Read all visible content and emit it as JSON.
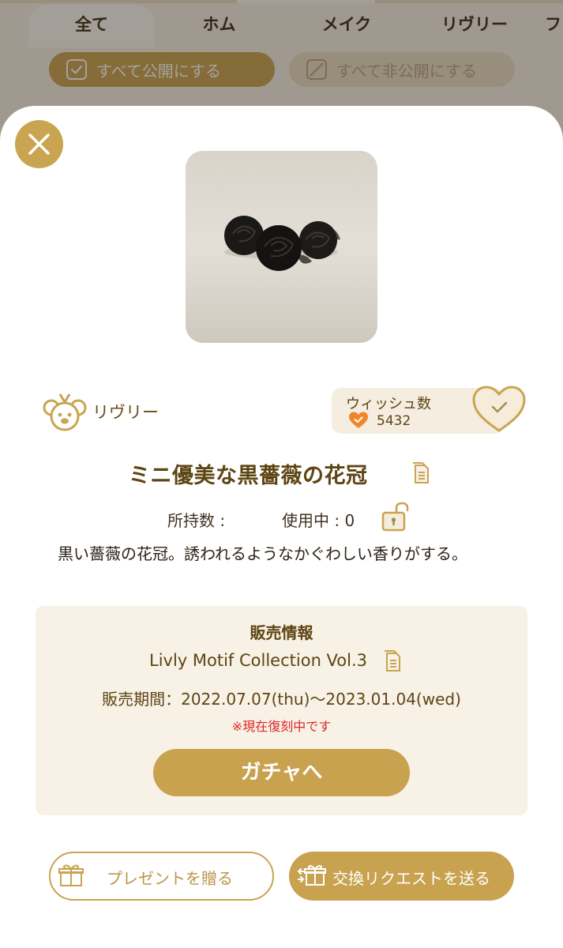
{
  "tabs": [
    {
      "label": "全て",
      "active": true
    },
    {
      "label": "ホム",
      "active": false
    },
    {
      "label": "メイク",
      "active": false
    },
    {
      "label": "リヴリー",
      "active": false
    },
    {
      "label": "フ",
      "active": false
    }
  ],
  "bulk_actions": {
    "publish_all": "すべて公開にする",
    "unpublish_all": "すべて非公開にする"
  },
  "modal": {
    "close_icon": "close-icon",
    "category_label": "リヴリー",
    "category_icon": "livly-face-icon",
    "wish": {
      "title": "ウィッシュ数",
      "count": "5432",
      "icon": "heart-icon"
    },
    "item_name": "ミニ優美な黒薔薇の花冠",
    "owned_label": "所持数 :",
    "owned_value": "",
    "in_use_label": "使用中 : 0",
    "description": "黒い薔薇の花冠。誘われるようなかぐわしい香りがする。",
    "sales": {
      "title": "販売情報",
      "collection": "Livly Motif Collection Vol.3",
      "period": "販売期間：2022.07.07(thu)〜2023.01.04(wed)",
      "note": "※現在復刻中です",
      "gacha_button": "ガチャへ"
    },
    "present_button": "プレゼントを贈る",
    "trade_button": "交換リクエストを送る"
  },
  "colors": {
    "gold": "#c8a24f",
    "brown_text": "#5e4514",
    "sales_bg": "#f7f1e6",
    "note_red": "#e02626",
    "wish_heart_orange": "#f0862a"
  }
}
